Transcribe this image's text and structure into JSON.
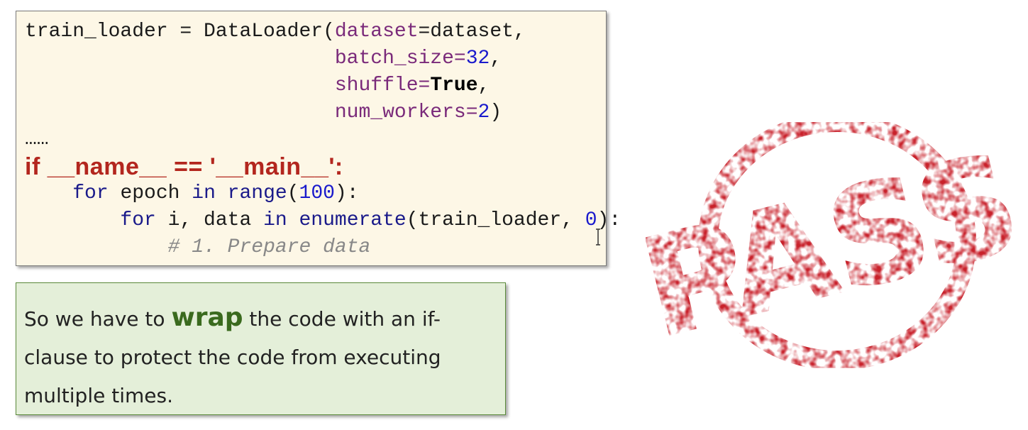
{
  "code": {
    "l1_a": "train_loader = DataLoader(",
    "l1_arg": "dataset",
    "l1_b": "=dataset,",
    "l2_arg": "batch_size",
    "l2_eq": "=",
    "l2_num": "32",
    "l2_c": ",",
    "l3_arg": "shuffle",
    "l3_eq": "=",
    "l3_const": "True",
    "l3_c": ",",
    "l4_arg": "num_workers",
    "l4_eq": "=",
    "l4_num": "2",
    "l4_c": ")",
    "ellipsis": "……",
    "main_guard": "if __name__ == '__main__':",
    "l6_kw": "for",
    "l6_a": " epoch ",
    "l6_in": "in",
    "l6_fn": " range",
    "l6_b": "(",
    "l6_num": "100",
    "l6_c": "):",
    "l7_kw": "for",
    "l7_a": " i, data ",
    "l7_in": "in",
    "l7_fn": " enumerate",
    "l7_b": "(train_loader, ",
    "l7_num": "0",
    "l7_c": "):",
    "l8_comment": "# 1. Prepare data"
  },
  "note": {
    "pre": "So we have to ",
    "emphasis": "wrap",
    "post": " the code with an if-clause to protect the code from executing multiple times."
  },
  "stamp": {
    "text": "PASS",
    "color": "#c8202a"
  }
}
